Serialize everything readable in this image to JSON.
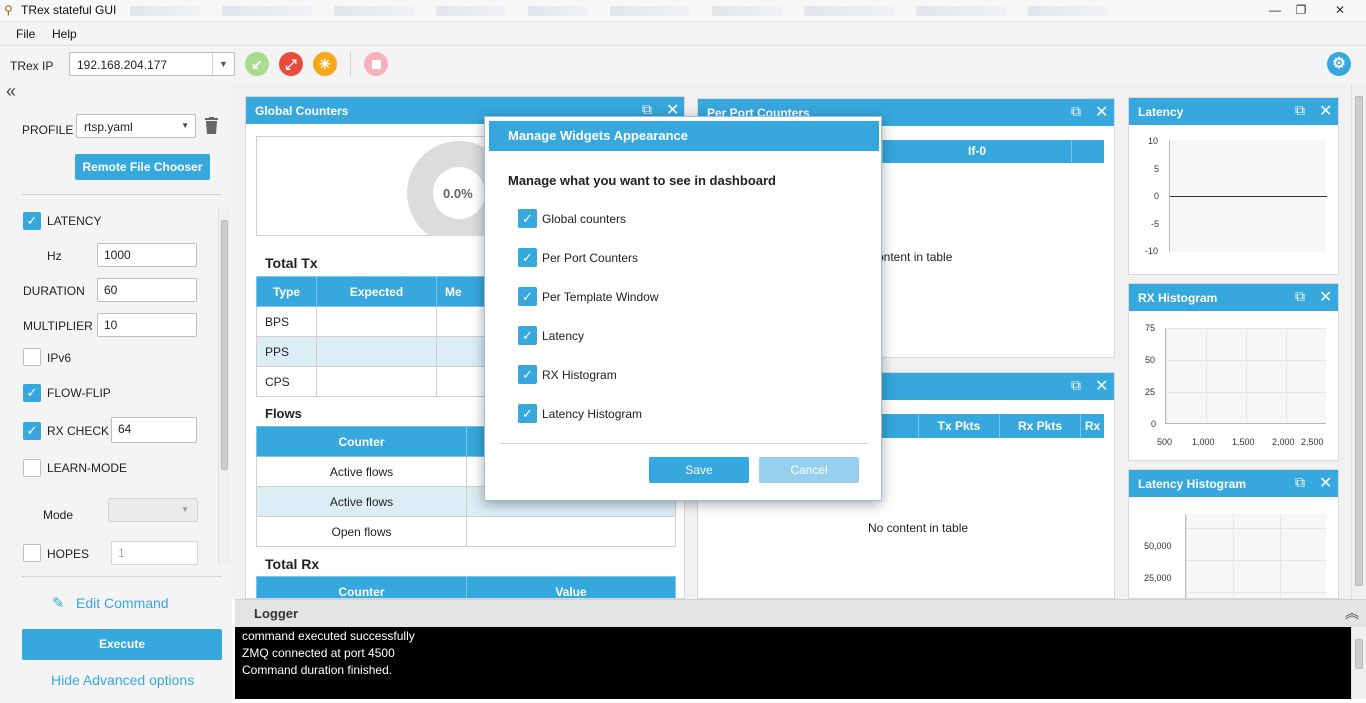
{
  "window": {
    "title": "TRex stateful GUI",
    "controls": {
      "minimize": "—",
      "maximize": "❐",
      "close": "✕"
    }
  },
  "menu": {
    "file": "File",
    "help": "Help"
  },
  "toolbar": {
    "trex_ip_label": "TRex IP",
    "trex_ip_value": "192.168.204.177",
    "buttons": [
      "connect-icon",
      "disconnect-icon",
      "refresh-icon",
      "stop-icon"
    ],
    "settings_icon": "gear-icon"
  },
  "side": {
    "collapse_icon": "«",
    "profile_label": "PROFILE",
    "profile_value": "rtsp.yaml",
    "remote_file_chooser": "Remote File Chooser",
    "latency": {
      "label": "LATENCY",
      "checked": true
    },
    "hz_label": "Hz",
    "hz_value": "1000",
    "duration_label": "DURATION",
    "duration_value": "60",
    "multiplier_label": "MULTIPLIER",
    "multiplier_value": "10",
    "ipv6": {
      "label": "IPv6",
      "checked": false
    },
    "flow_flip": {
      "label": "FLOW-FLIP",
      "checked": true
    },
    "rx_check": {
      "label": "RX CHECK",
      "checked": true,
      "value": "64"
    },
    "learn_mode": {
      "label": "LEARN-MODE",
      "checked": false
    },
    "mode_label": "Mode",
    "mode_value": "",
    "hopes": {
      "label": "HOPES",
      "checked": false,
      "value": "1"
    },
    "edit_command": "Edit Command",
    "execute": "Execute",
    "hide_advanced": "Hide Advanced options"
  },
  "global_counters": {
    "title": "Global Counters",
    "gauge_value": "0.0%",
    "total_tx_title": "Total Tx",
    "tx_headers": [
      "Type",
      "Expected",
      "Me"
    ],
    "tx_rows": [
      "BPS",
      "PPS",
      "CPS"
    ],
    "flows_title": "Flows",
    "flows_header": "Counter",
    "flows_rows": [
      "Active flows",
      "Active flows",
      "Open flows"
    ],
    "total_rx_title": "Total Rx",
    "rx_headers": [
      "Counter",
      "Value"
    ]
  },
  "per_port": {
    "title": "Per Port Counters",
    "header_col": "If-0",
    "empty": "ontent in table"
  },
  "per_template": {
    "headers": [
      "Tx Pkts",
      "Rx Pkts",
      "Rx"
    ],
    "empty": "No content in table"
  },
  "latency": {
    "title": "Latency",
    "y_ticks": [
      "10",
      "5",
      "0",
      "-5",
      "-10"
    ]
  },
  "rx_histogram": {
    "title": "RX Histogram",
    "y_ticks": [
      "75",
      "50",
      "25",
      "0"
    ],
    "x_ticks": [
      "500",
      "1,000",
      "1,500",
      "2,000",
      "2,500"
    ]
  },
  "latency_histogram": {
    "title": "Latency Histogram",
    "y_ticks": [
      "50,000",
      "25,000"
    ]
  },
  "dialog": {
    "title": "Manage Widgets Appearance",
    "subtitle": "Manage what you want to see in dashboard",
    "options": [
      "Global counters",
      "Per Port Counters",
      "Per Template Window",
      "Latency",
      "RX Histogram",
      "Latency Histogram"
    ],
    "save": "Save",
    "cancel": "Cancel"
  },
  "logger": {
    "title": "Logger",
    "lines": [
      "command executed successfully",
      "ZMQ connected at port 4500",
      "Command duration finished."
    ]
  },
  "colors": {
    "accent": "#36a8de",
    "connect": "#a9dc8c",
    "disconnect": "#e84c3d",
    "refresh": "#f6a81b",
    "stop": "#f5b3b5"
  }
}
